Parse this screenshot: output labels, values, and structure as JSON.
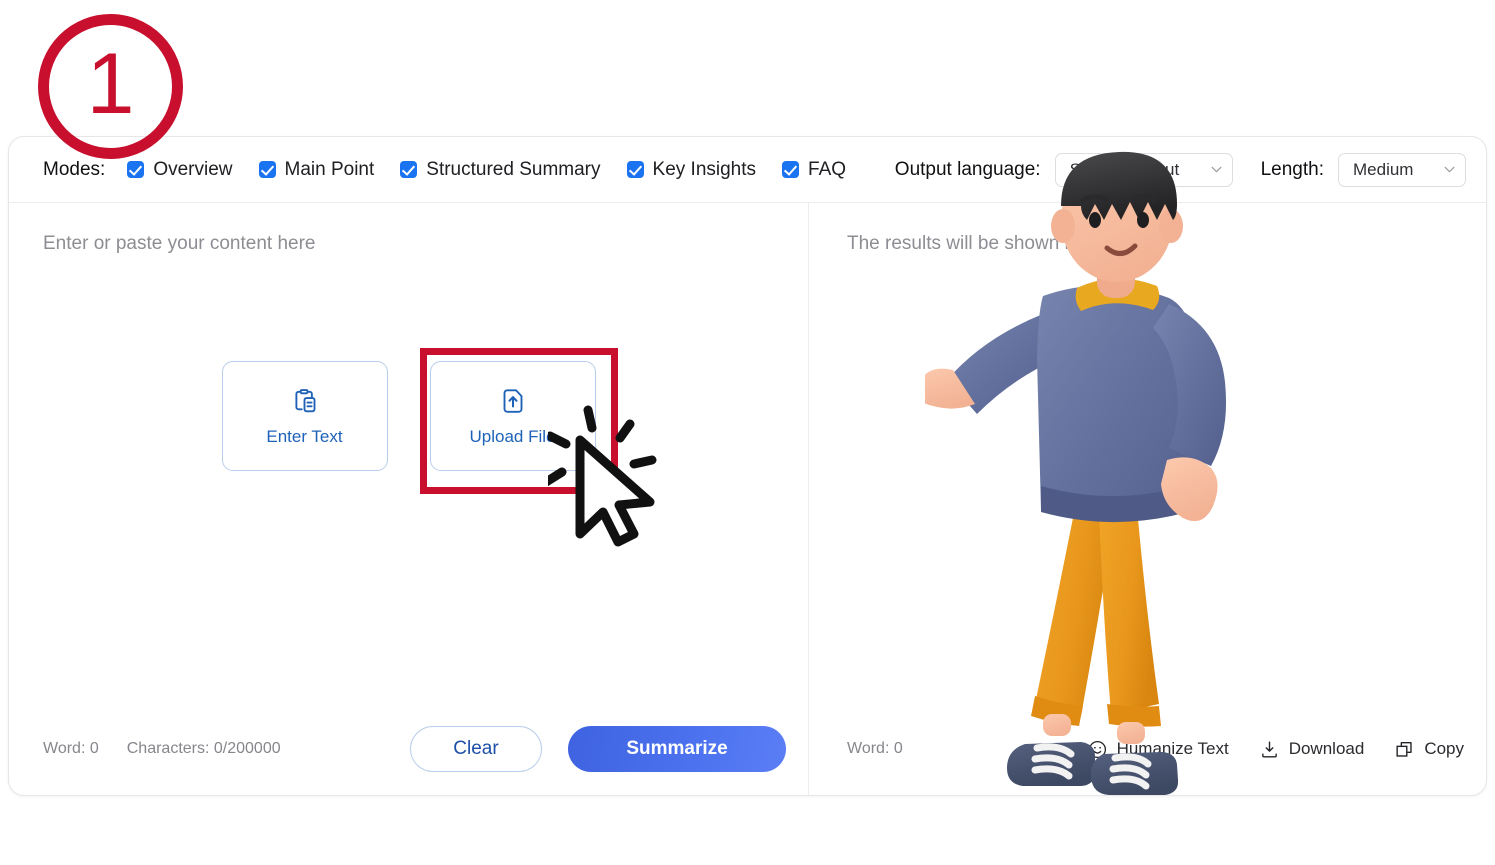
{
  "step_badge": {
    "number": "1"
  },
  "toolbar": {
    "modes_label": "Modes:",
    "modes": [
      {
        "label": "Overview",
        "checked": true
      },
      {
        "label": "Main Point",
        "checked": true
      },
      {
        "label": "Structured Summary",
        "checked": true
      },
      {
        "label": "Key Insights",
        "checked": true
      },
      {
        "label": "FAQ",
        "checked": true
      }
    ],
    "output_language_label": "Output language:",
    "output_language_value": "Same as Input",
    "length_label": "Length:",
    "length_value": "Medium"
  },
  "input_pane": {
    "placeholder": "Enter or paste your content here",
    "tiles": [
      {
        "label": "Enter Text",
        "icon": "clipboard-paste-icon"
      },
      {
        "label": "Upload File",
        "icon": "file-upload-icon"
      }
    ],
    "word_count": "Word: 0",
    "character_count": "Characters: 0/200000",
    "clear_label": "Clear",
    "summarize_label": "Summarize"
  },
  "output_pane": {
    "placeholder": "The results will be shown here",
    "word_count": "Word: 0",
    "tools": [
      {
        "label": "Humanize Text",
        "icon": "smiley-icon"
      },
      {
        "label": "Download",
        "icon": "download-icon"
      },
      {
        "label": "Copy",
        "icon": "copy-icon"
      }
    ]
  },
  "annotations": {
    "highlight_target": "Upload File",
    "cursor": "click-cursor"
  },
  "colors": {
    "accent_blue": "#1a73f0",
    "tile_blue": "#1e62b8",
    "annotation_red": "#c8102e",
    "summarize_gradient_start": "#3f63e0",
    "summarize_gradient_end": "#5b7ef5"
  }
}
